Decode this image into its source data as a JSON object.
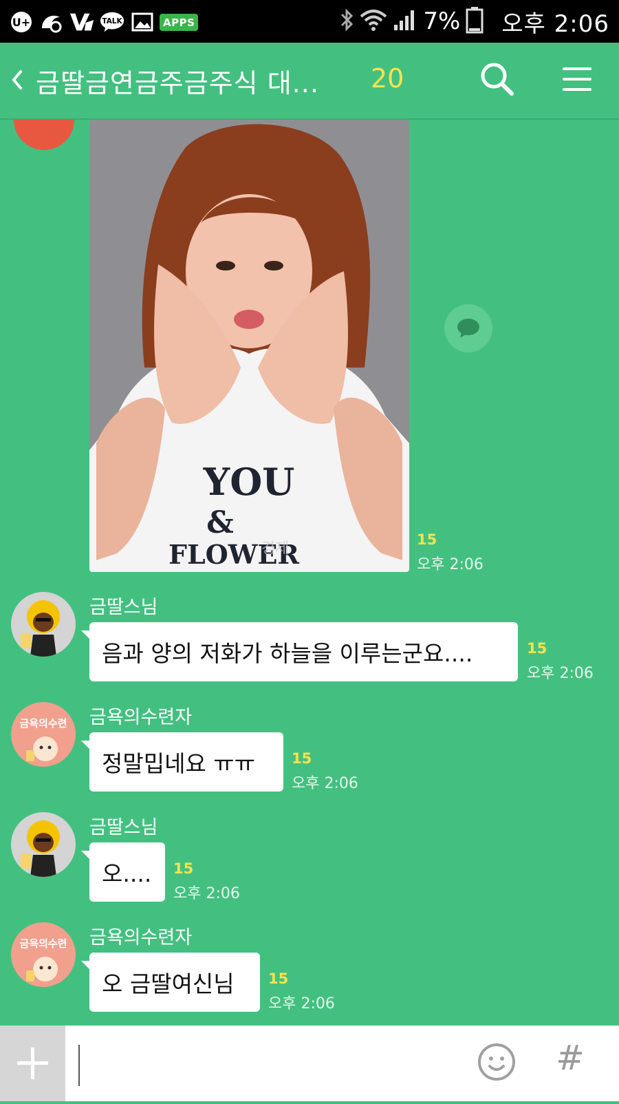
{
  "status_bar": {
    "icons": [
      "uplus-icon",
      "uc-browser-icon",
      "vs-icon",
      "kakaotalk-icon",
      "gallery-icon",
      "apps-icon"
    ],
    "apps_label": "APPS",
    "talk_label": "TALK",
    "battery_percent": "7%",
    "time": "오후 2:06"
  },
  "header": {
    "title": "금딸금연금주금주식 대...",
    "member_count": "20"
  },
  "messages": [
    {
      "type": "image",
      "unread": "15",
      "time": "오후 2:06"
    },
    {
      "sender": "금딸스님",
      "text": "음과 양의 저화가 하늘을 이루는군요....",
      "unread": "15",
      "time": "오후 2:06"
    },
    {
      "sender": "금욕의수련자",
      "avatar_text": "금욕의수련",
      "text": "정말밉네요 ㅠㅠ",
      "unread": "15",
      "time": "오후 2:06"
    },
    {
      "sender": "금딸스님",
      "text": "오....",
      "unread": "15",
      "time": "오후 2:06"
    },
    {
      "sender": "금욕의수련자",
      "avatar_text": "금욕의수련",
      "text": "오 금딸여신님",
      "unread": "15",
      "time": "오후 2:06"
    }
  ],
  "photo": {
    "shirt_text": [
      "YOU",
      "&",
      "FLOWER"
    ],
    "watermark": "경제"
  },
  "input": {
    "placeholder": "",
    "value": ""
  },
  "colors": {
    "background": "#43c080",
    "unread": "#ffe14d",
    "bubble": "#ffffff"
  }
}
